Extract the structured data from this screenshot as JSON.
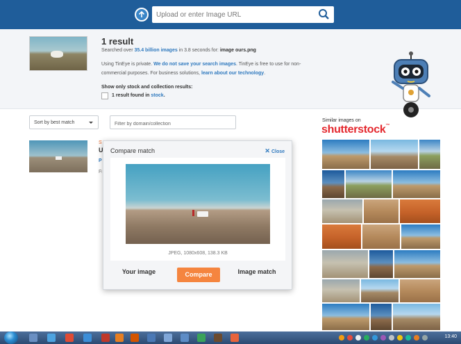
{
  "search": {
    "placeholder": "Upload or enter Image URL"
  },
  "summary": {
    "count": "1 result",
    "searched_prefix": "Searched over ",
    "searched_count": "35.4 billion images",
    "searched_mid": " in 3.8 seconds for: ",
    "searched_file": "image ours.png",
    "private_a": "Using TinEye is private. ",
    "private_link": "We do not save your search images",
    "private_b": ". TinEye is free to use for non-commercial purposes. For business solutions, ",
    "private_link2": "learn about our technology",
    "private_c": ".",
    "stock_heading": "Show only stock and collection results:",
    "stock_label_a": "1 result found in ",
    "stock_label_link": "stock",
    "stock_label_b": "."
  },
  "controls": {
    "sort_label": "Sort by best match",
    "filter_placeholder": "Filter by domain/collection"
  },
  "result_partial": {
    "line1": "ST",
    "line2": "U",
    "line3": "P",
    "line4": "Fi"
  },
  "modal": {
    "title": "Compare match",
    "close": "Close",
    "meta": "JPEG, 1080x608, 138.3 KB",
    "tab_your": "Your image",
    "tab_compare": "Compare",
    "tab_match": "Image match"
  },
  "shutterstock": {
    "heading": "Similar images on",
    "logo": "shutterstock"
  },
  "taskbar": {
    "time": "13:40"
  }
}
